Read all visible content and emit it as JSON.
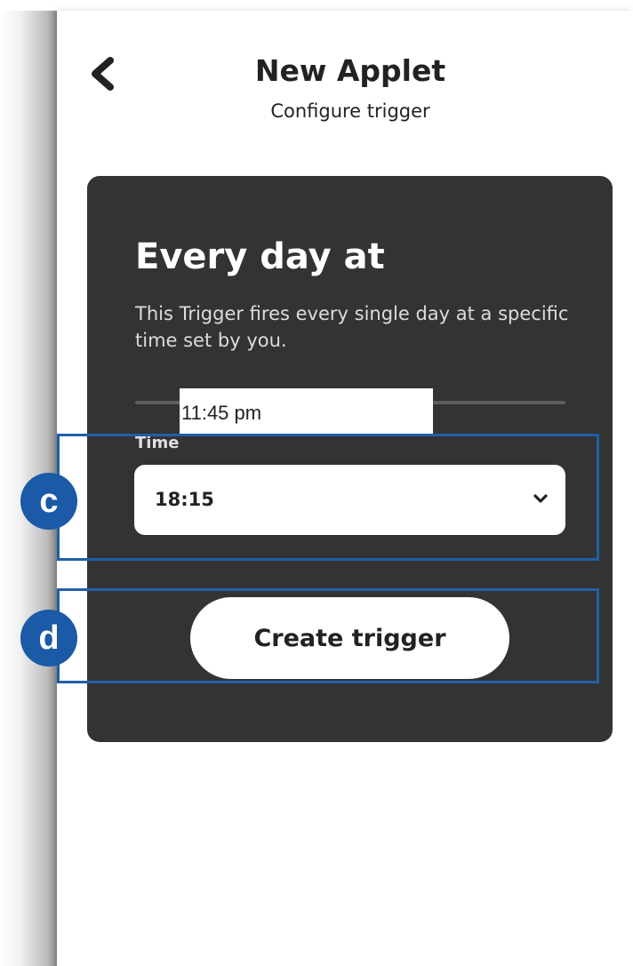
{
  "header": {
    "title": "New Applet",
    "subtitle": "Configure trigger",
    "back_icon": "chevron-left-icon"
  },
  "trigger_card": {
    "title": "Every day at",
    "description": "This Trigger fires every single day at a specific time set by you.",
    "tooltip_time": "11:45 pm",
    "time_field": {
      "label": "Time",
      "value": "18:15",
      "icon": "chevron-down-icon"
    },
    "create_button": "Create trigger"
  },
  "annotations": {
    "c": "c",
    "d": "d"
  },
  "colors": {
    "card_background": "#333333",
    "annotation_blue": "#1a5aa6",
    "text_dark": "#222222"
  }
}
